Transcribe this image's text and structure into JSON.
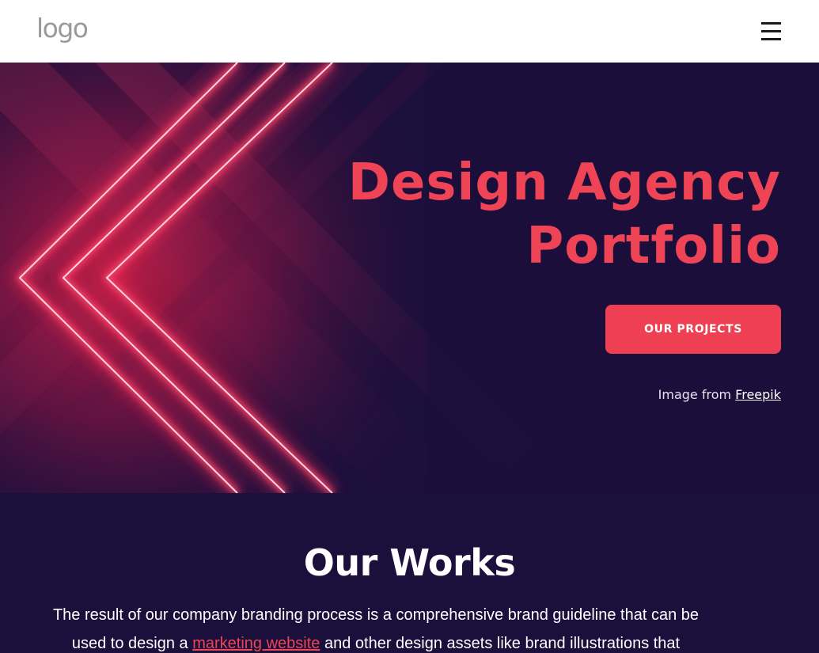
{
  "header": {
    "logo_text": "logo",
    "menu_icon": "hamburger-menu-icon"
  },
  "hero": {
    "title_line1": "Design Agency",
    "title_line2": "Portfolio",
    "cta_label": "OUR PROJECTS",
    "credit_prefix": "Image from ",
    "credit_link": "Freepik"
  },
  "works": {
    "title": "Our Works",
    "text_part1": "The result of our company branding process is a comprehensive brand guideline that can be used to design a ",
    "text_link": "marketing website",
    "text_part2": " and other design assets like brand illustrations that"
  },
  "colors": {
    "background": "#1b0f3b",
    "accent": "#ee4455",
    "header_bg": "#ffffff"
  }
}
